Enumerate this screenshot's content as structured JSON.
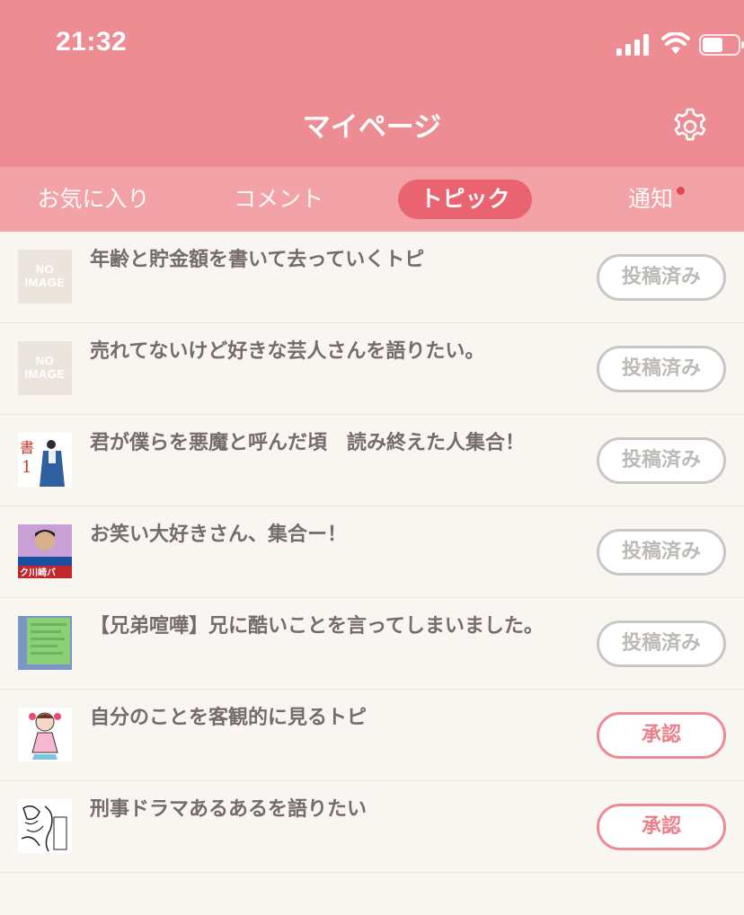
{
  "status_bar": {
    "time": "21:32"
  },
  "header": {
    "title": "マイページ",
    "settings_icon": "gear-icon"
  },
  "tabs": [
    {
      "label": "お気に入り",
      "active": false
    },
    {
      "label": "コメント",
      "active": false
    },
    {
      "label": "トピック",
      "active": true
    },
    {
      "label": "通知",
      "active": false,
      "has_notification": true
    }
  ],
  "topics": [
    {
      "title": "年齢と貯金額を書いて去っていくトピ",
      "thumb": "no-image",
      "thumb_text": "NO IMAGE",
      "status": "投稿済み"
    },
    {
      "title": "売れてないけど好きな芸人さんを語りたい。",
      "thumb": "no-image",
      "thumb_text": "NO IMAGE",
      "status": "投稿済み"
    },
    {
      "title": "君が僕らを悪魔と呼んだ頃　読み終えた人集合！",
      "thumb": "manga-cover",
      "status": "投稿済み"
    },
    {
      "title": "お笑い大好きさん、集合ー！",
      "thumb": "comedian-photo",
      "status": "投稿済み"
    },
    {
      "title": "【兄弟喧嘩】兄に酷いことを言ってしまいました。",
      "thumb": "chat-screenshot",
      "status": "投稿済み"
    },
    {
      "title": "自分のことを客観的に見るトピ",
      "thumb": "cartoon-girl",
      "status": "承認"
    },
    {
      "title": "刑事ドラマあるあるを語りたい",
      "thumb": "manga-sketch",
      "status": "承認"
    }
  ],
  "colors": {
    "header": "#ee8c93",
    "tabbar": "#f3a3a7",
    "active_tab": "#e9616e",
    "background": "#f9f5f0",
    "posted_border": "#c9c7c3",
    "approve_border": "#ee8a94"
  }
}
